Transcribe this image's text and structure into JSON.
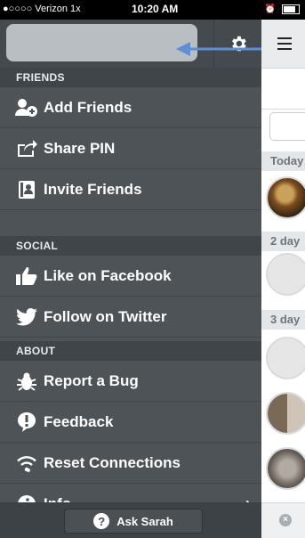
{
  "status_bar": {
    "carrier": "●○○○○ Verizon  1x",
    "time": "10:20 AM"
  },
  "sidebar": {
    "sections": [
      {
        "label": "FRIENDS"
      },
      {
        "label": "SOCIAL"
      },
      {
        "label": "ABOUT"
      }
    ],
    "items": [
      {
        "label": "Add Friends",
        "icon": "add-friends-icon"
      },
      {
        "label": "Share PIN",
        "icon": "share-icon"
      },
      {
        "label": "Invite Friends",
        "icon": "address-book-icon"
      },
      {
        "label": "Like on Facebook",
        "icon": "thumbs-up-icon"
      },
      {
        "label": "Follow on Twitter",
        "icon": "twitter-bird-icon"
      },
      {
        "label": "Report a Bug",
        "icon": "bug-icon"
      },
      {
        "label": "Feedback",
        "icon": "feedback-icon"
      },
      {
        "label": "Reset Connections",
        "icon": "wifi-icon"
      },
      {
        "label": "Info",
        "icon": "info-icon"
      }
    ],
    "ask_button": {
      "label": "Ask Sarah"
    }
  },
  "content": {
    "day_headers": [
      "Today",
      "2 day",
      "3 day"
    ]
  },
  "colors": {
    "sidebar_bg": "#4d5357",
    "section_bg": "#3f4549",
    "arrow": "#5b8fd6"
  }
}
